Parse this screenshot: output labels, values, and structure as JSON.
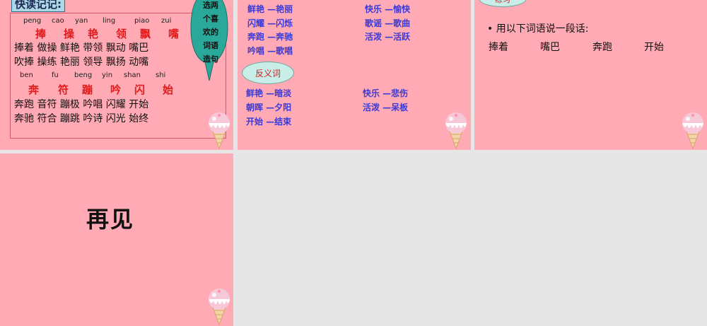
{
  "slide1": {
    "title": "快读记记:",
    "pinyin_row1": [
      "peng",
      "cao",
      "yan",
      "ling",
      "piao",
      "zui"
    ],
    "chars_row1": [
      "捧",
      "操",
      "艳",
      "领",
      "飘",
      "嘴"
    ],
    "words_row1": [
      "捧着",
      "做操",
      "鲜艳",
      "带领",
      "飘动",
      "嘴巴"
    ],
    "words_row2": [
      "吹捧",
      "操练",
      "艳丽",
      "领导",
      "飘扬",
      "动嘴"
    ],
    "pinyin_row2": [
      "ben",
      "fu",
      "beng",
      "yin",
      "shan",
      "shi"
    ],
    "chars_row2": [
      "奔",
      "符",
      "蹦",
      "吟",
      "闪",
      "始"
    ],
    "words_row3": [
      "奔跑",
      "音符",
      "蹦极",
      "吟唱",
      "闪耀",
      "开始"
    ],
    "words_row4": [
      "奔驰",
      "符合",
      "蹦跳",
      "吟诗",
      "闪光",
      "始终"
    ],
    "bubble": [
      "选两",
      "个喜",
      "欢的",
      "词语",
      "造句"
    ]
  },
  "slide2": {
    "synonyms_left": [
      "鲜艳 —艳丽",
      "闪耀 —闪烁",
      "奔跑 —奔驰",
      "吟唱 —歌唱"
    ],
    "synonyms_right": [
      "快乐 —愉快",
      "歌谣 —歌曲",
      "活泼 —活跃"
    ],
    "antonym_badge": "反义词",
    "antonyms_left": [
      "鲜艳 —暗淡",
      "朝晖 —夕阳",
      "开始 —结束"
    ],
    "antonyms_right": [
      "快乐 —悲伤",
      "活泼 —呆板"
    ]
  },
  "slide3": {
    "badge": "练习",
    "instruction": "• 用以下词语说一段话:",
    "words": [
      "捧着",
      "嘴巴",
      "奔跑",
      "开始"
    ]
  },
  "slide4": {
    "farewell": "再见"
  },
  "colors": {
    "slide_bg": "#ffaab4",
    "red": "#e11a1a",
    "blue": "#3a3ad8",
    "teal": "#2aa89a"
  }
}
